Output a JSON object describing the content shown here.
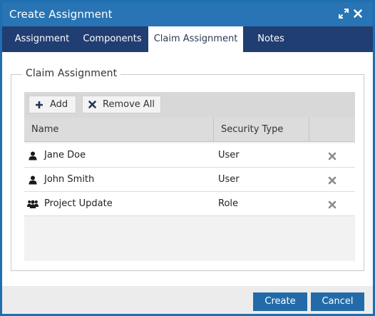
{
  "window": {
    "title": "Create Assignment",
    "icons": {
      "maximize": "expand-arrows-icon",
      "close": "close-x-icon"
    }
  },
  "tabs": [
    {
      "label": "Assignment",
      "active": false
    },
    {
      "label": "Components",
      "active": false
    },
    {
      "label": "Claim Assignment",
      "active": true
    },
    {
      "label": "Notes",
      "active": false
    }
  ],
  "section": {
    "legend": "Claim Assignment"
  },
  "toolbar": {
    "add_label": "Add",
    "add_icon": "plus-icon",
    "remove_all_label": "Remove All",
    "remove_all_icon": "x-icon"
  },
  "table": {
    "columns": [
      "Name",
      "Security Type",
      ""
    ],
    "rows": [
      {
        "icon": "user-icon",
        "name": "Jane Doe",
        "security_type": "User"
      },
      {
        "icon": "user-icon",
        "name": "John Smith",
        "security_type": "User"
      },
      {
        "icon": "users-group-icon",
        "name": "Project Update",
        "security_type": "Role"
      }
    ]
  },
  "footer": {
    "create_label": "Create",
    "cancel_label": "Cancel"
  },
  "colors": {
    "titlebar": "#2874b4",
    "tabbar": "#213e73",
    "primary_button": "#236ba8",
    "border": "#1d6fb0"
  }
}
